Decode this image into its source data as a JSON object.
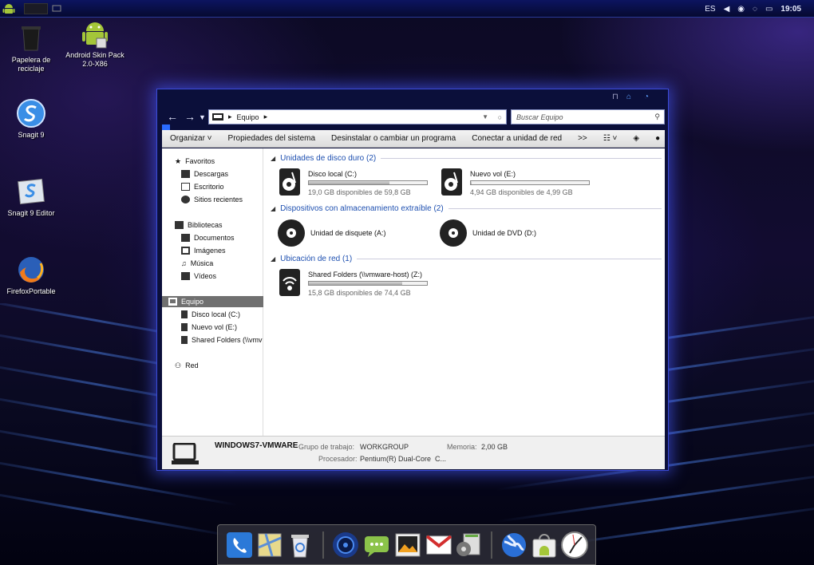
{
  "taskbar": {
    "language": "ES",
    "clock": "19:05"
  },
  "desktop": {
    "icons": [
      {
        "label": "Papelera de reciclaje",
        "icon": "recycle-bin-icon"
      },
      {
        "label": "Android Skin Pack 2.0-X86",
        "icon": "android-icon"
      },
      {
        "label": "Snagit 9",
        "icon": "snagit-icon"
      },
      {
        "label": "Snagit 9 Editor",
        "icon": "snagit-editor-icon"
      },
      {
        "label": "FirefoxPortable",
        "icon": "firefox-icon"
      }
    ]
  },
  "window": {
    "address": "Equipo",
    "search_placeholder": "Buscar Equipo",
    "toolbar": [
      "Organizar",
      "Propiedades del sistema",
      "Desinstalar o cambiar un programa",
      "Conectar a unidad de red",
      ">>"
    ],
    "nav": {
      "favorites": {
        "label": "Favoritos",
        "items": [
          "Descargas",
          "Escritorio",
          "Sitios recientes"
        ]
      },
      "libraries": {
        "label": "Bibliotecas",
        "items": [
          "Documentos",
          "Imágenes",
          "Música",
          "Vídeos"
        ]
      },
      "computer": {
        "label": "Equipo",
        "items": [
          "Disco local (C:)",
          "Nuevo vol (E:)",
          "Shared Folders (\\\\vmv"
        ]
      },
      "network": {
        "label": "Red"
      }
    },
    "groups": [
      {
        "title": "Unidades de disco duro (2)",
        "drives": [
          {
            "name": "Disco local (C:)",
            "free": "19,0 GB disponibles de 59,8 GB",
            "used_fraction": 0.68
          },
          {
            "name": "Nuevo vol (E:)",
            "free": "4,94 GB disponibles de 4,99 GB",
            "used_fraction": 0.01
          }
        ]
      },
      {
        "title": "Dispositivos con almacenamiento extraíble (2)",
        "drives": [
          {
            "name": "Unidad de disquete (A:)"
          },
          {
            "name": "Unidad de DVD (D:)"
          }
        ]
      },
      {
        "title": "Ubicación de red (1)",
        "drives": [
          {
            "name": "Shared Folders (\\\\vmware-host) (Z:)",
            "free": "15,8 GB disponibles de 74,4 GB",
            "used_fraction": 0.79
          }
        ]
      }
    ],
    "details": {
      "pc_name": "WINDOWS7-VMWARE",
      "workgroup_label": "Grupo de trabajo:",
      "workgroup": "WORKGROUP",
      "memory_label": "Memoria:",
      "memory": "2,00 GB",
      "cpu_label": "Procesador:",
      "cpu": "Pentium(R) Dual-Core  C..."
    }
  },
  "dock": {
    "items": [
      "phone-icon",
      "maps-icon",
      "recycle-bin-icon",
      "speaker-icon",
      "messaging-icon",
      "gallery-icon",
      "gmail-icon",
      "settings-icon",
      "browser-globe-icon",
      "market-icon",
      "clock-icon"
    ]
  }
}
